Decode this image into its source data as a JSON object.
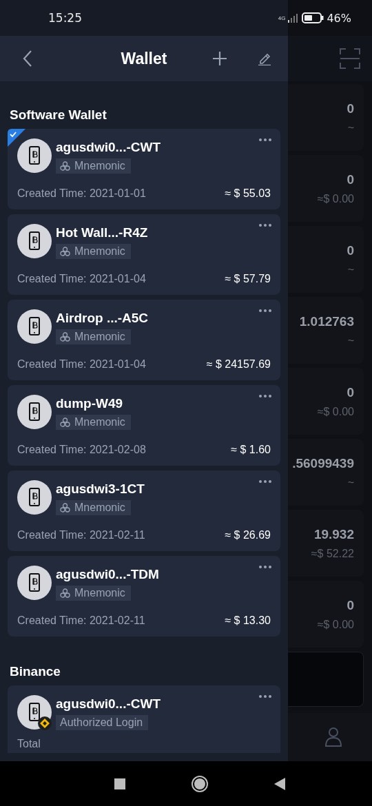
{
  "status_bar": {
    "time": "15:25",
    "network": "4G",
    "battery": "46%"
  },
  "header": {
    "title": "Wallet"
  },
  "sections": [
    {
      "title": "Software Wallet",
      "wallets": [
        {
          "kind": "software",
          "name": "agusdwi0...-CWT",
          "tag": "Mnemonic",
          "created": "Created Time: 2021-01-01",
          "balance": "≈ $ 55.03",
          "selected": true
        },
        {
          "kind": "software",
          "name": "Hot Wall...-R4Z",
          "tag": "Mnemonic",
          "created": "Created Time: 2021-01-04",
          "balance": "≈ $ 57.79",
          "selected": false
        },
        {
          "kind": "software",
          "name": "Airdrop ...-A5C",
          "tag": "Mnemonic",
          "created": "Created Time: 2021-01-04",
          "balance": "≈ $ 24157.69",
          "selected": false
        },
        {
          "kind": "software",
          "name": "dump-W49",
          "tag": "Mnemonic",
          "created": "Created Time: 2021-02-08",
          "balance": "≈ $ 1.60",
          "selected": false
        },
        {
          "kind": "software",
          "name": "agusdwi3-1CT",
          "tag": "Mnemonic",
          "created": "Created Time: 2021-02-11",
          "balance": "≈ $ 26.69",
          "selected": false
        },
        {
          "kind": "software",
          "name": "agusdwi0...-TDM",
          "tag": "Mnemonic",
          "created": "Created Time: 2021-02-11",
          "balance": "≈ $ 13.30",
          "selected": false
        }
      ]
    },
    {
      "title": "Binance",
      "wallets": [
        {
          "kind": "exchange",
          "name": "agusdwi0...-CWT",
          "tag": "Authorized Login",
          "total_label": "Total",
          "selected": false
        }
      ]
    }
  ],
  "assets": [
    {
      "amount": "0",
      "value": "~"
    },
    {
      "amount": "0",
      "value": "≈$ 0.00"
    },
    {
      "amount": "0",
      "value": "~"
    },
    {
      "amount": "1.012763",
      "value": "~"
    },
    {
      "amount": "0",
      "value": "≈$ 0.00"
    },
    {
      "amount": ".56099439",
      "value": "~"
    },
    {
      "amount": "19.932",
      "value": "≈$ 52.22"
    },
    {
      "amount": "0",
      "value": "≈$ 0.00"
    }
  ]
}
